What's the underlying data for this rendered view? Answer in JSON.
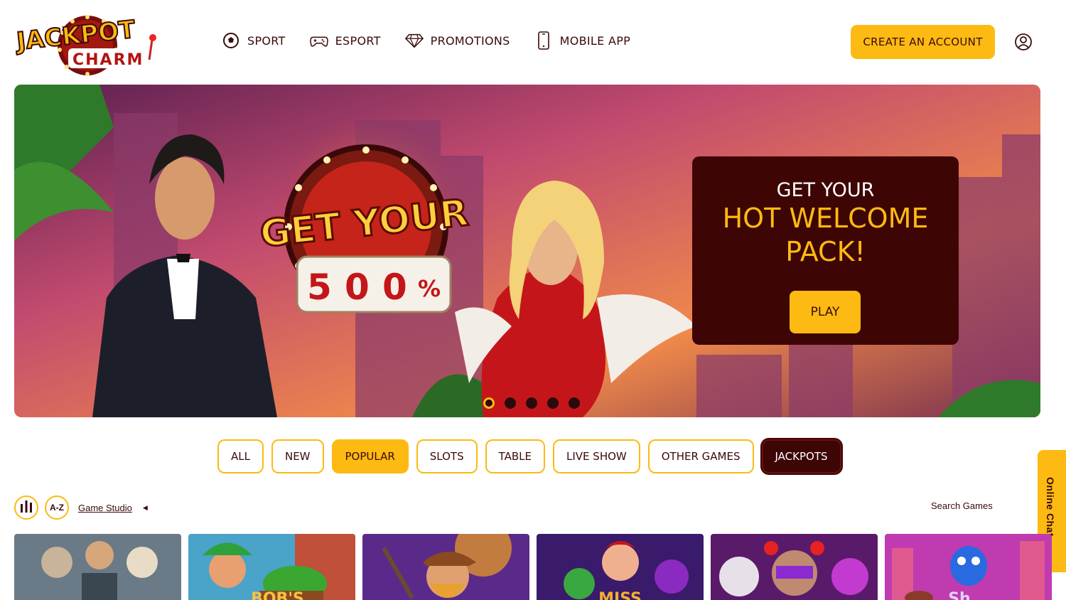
{
  "brand": {
    "logo_word1": "JACKPOT",
    "logo_word2": "CHARM",
    "accent": "#fcba12",
    "dark": "#3e0505"
  },
  "nav": [
    {
      "label": "SPORT",
      "icon": "soccer-ball-icon"
    },
    {
      "label": "ESPORT",
      "icon": "gamepad-icon"
    },
    {
      "label": "PROMOTIONS",
      "icon": "diamond-icon"
    },
    {
      "label": "MOBILE APP",
      "icon": "mobile-phone-icon"
    }
  ],
  "header": {
    "create_account": "CREATE AN ACCOUNT",
    "user_icon": "user-icon"
  },
  "hero": {
    "banner_headline": "GET YOUR",
    "banner_digits": [
      "5",
      "0",
      "0"
    ],
    "banner_percent": "%",
    "promo_line1": "GET YOUR",
    "promo_line2": "HOT WELCOME PACK!",
    "play_label": "PLAY",
    "slides_total": 5,
    "active_slide": 1
  },
  "filters": {
    "items": [
      "ALL",
      "NEW",
      "POPULAR",
      "SLOTS",
      "TABLE",
      "LIVE SHOW",
      "OTHER GAMES",
      "JACKPOTS"
    ],
    "active": "POPULAR"
  },
  "tools": {
    "az_label": "A-Z",
    "studio_label": "Game Studio",
    "search_label": "Search Games"
  },
  "chat": {
    "label": "Online Chat"
  },
  "tiles": [
    {
      "title": ""
    },
    {
      "title": "BOB'S"
    },
    {
      "title": ""
    },
    {
      "title": "MISS"
    },
    {
      "title": ""
    },
    {
      "title": "Sh..."
    }
  ]
}
